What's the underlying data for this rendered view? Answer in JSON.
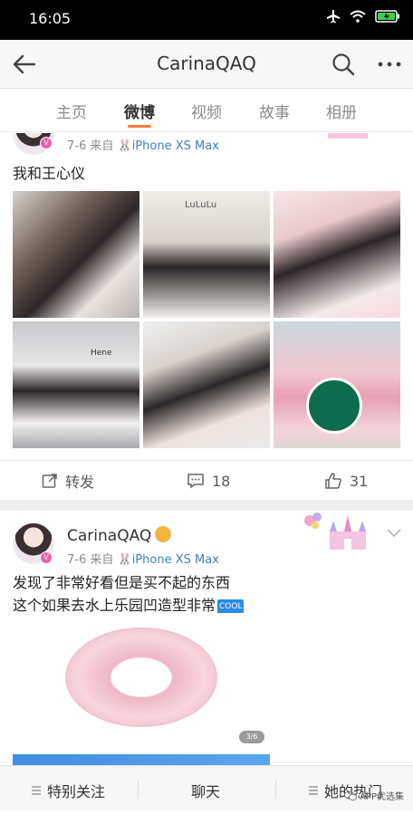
{
  "status_bar": {
    "time": "16:05"
  },
  "nav": {
    "title": "CarinaQAQ"
  },
  "tabs": [
    {
      "label": "主页"
    },
    {
      "label": "微博"
    },
    {
      "label": "视频"
    },
    {
      "label": "故事"
    },
    {
      "label": "相册"
    }
  ],
  "post1": {
    "date": "7-6",
    "source_prefix": "来自",
    "source": "iPhone XS Max",
    "text": "我和王心仪",
    "image_labels": {
      "deco1": "LuLuLu",
      "deco2": "Hene"
    },
    "actions": {
      "repost": "转发",
      "comments": "18",
      "likes": "31"
    }
  },
  "post2": {
    "username": "CarinaQAQ",
    "date": "7-6",
    "source_prefix": "来自",
    "source": "iPhone XS Max",
    "text_line1": "发现了非常好看但是买不起的东西",
    "text_line2": "这个如果去水上乐园凹造型非常",
    "cool_badge": "COOL",
    "page_indicator": "3/6"
  },
  "bottom_bar": {
    "special_follow": "特别关注",
    "chat": "聊天",
    "her_hot": "她的热门",
    "watermark": "APP优选集"
  },
  "colors": {
    "accent": "#fa7d3c",
    "link": "#3f7fc1",
    "verified": "#ef5ea8"
  },
  "icons": [
    "back-arrow-icon",
    "search-icon",
    "more-icon",
    "repost-icon",
    "comment-icon",
    "like-icon",
    "menu-lines-icon",
    "chevron-down-icon"
  ]
}
